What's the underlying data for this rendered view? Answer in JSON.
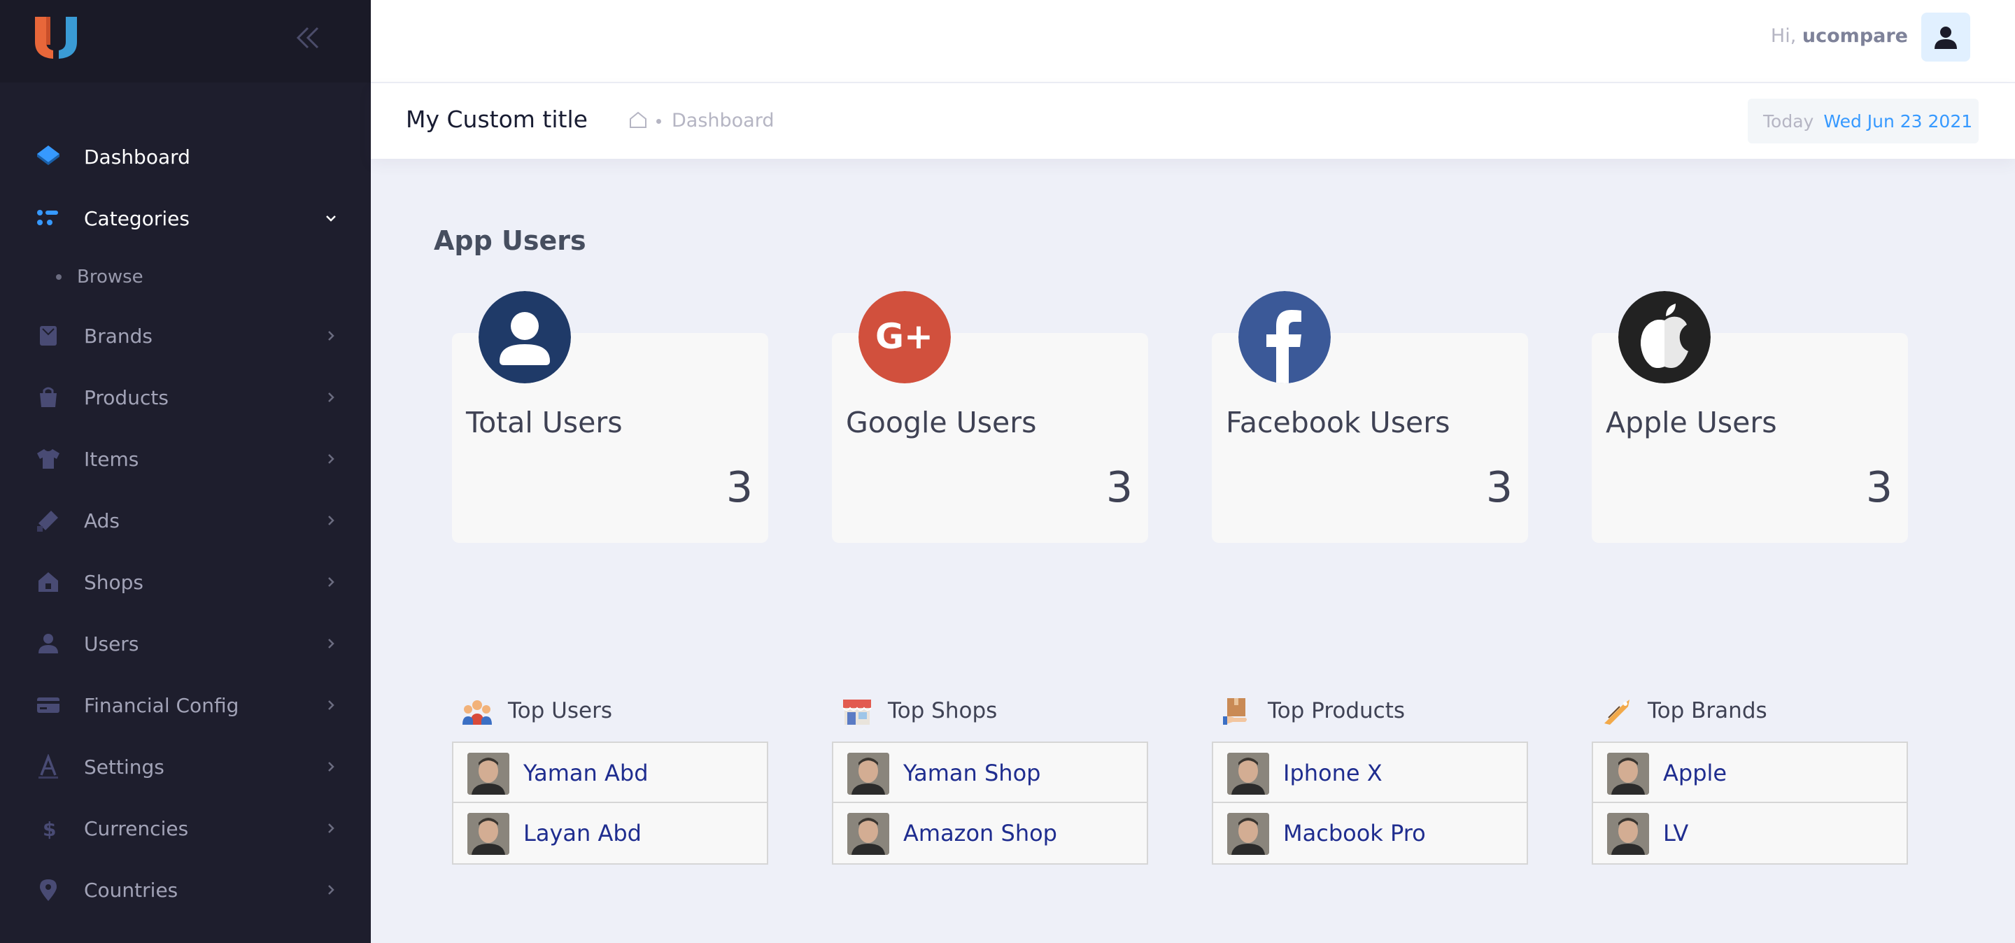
{
  "sidebar": {
    "items": [
      {
        "label": "Dashboard",
        "icon": "layers-icon"
      },
      {
        "label": "Categories",
        "icon": "categories-icon"
      },
      {
        "label": "Browse",
        "icon": "dot"
      },
      {
        "label": "Brands",
        "icon": "bookmark-icon"
      },
      {
        "label": "Products",
        "icon": "bag-icon"
      },
      {
        "label": "Items",
        "icon": "shirt-icon"
      },
      {
        "label": "Ads",
        "icon": "megaphone-icon"
      },
      {
        "label": "Shops",
        "icon": "home-icon"
      },
      {
        "label": "Users",
        "icon": "user-icon"
      },
      {
        "label": "Financial Config",
        "icon": "card-icon"
      },
      {
        "label": "Settings",
        "icon": "font-a-icon"
      },
      {
        "label": "Currencies",
        "icon": "dollar-icon"
      },
      {
        "label": "Countries",
        "icon": "map-marker-icon"
      }
    ]
  },
  "header": {
    "greeting": "Hi,",
    "username": "ucompare"
  },
  "subheader": {
    "title": "My Custom title",
    "breadcrumb": "Dashboard",
    "today_label": "Today",
    "date": "Wed Jun 23 2021"
  },
  "main": {
    "section_title": "App Users",
    "stats": [
      {
        "title": "Total Users",
        "value": "3",
        "icon": "user-circle-icon",
        "color": "#1f3a68"
      },
      {
        "title": "Google Users",
        "value": "3",
        "icon": "google-plus-icon",
        "color": "#d1503d"
      },
      {
        "title": "Facebook Users",
        "value": "3",
        "icon": "facebook-icon",
        "color": "#3b5998"
      },
      {
        "title": "Apple Users",
        "value": "3",
        "icon": "apple-icon",
        "color": "#222222"
      }
    ],
    "tops": [
      {
        "title": "Top Users",
        "icon": "users-group-icon",
        "rows": [
          "Yaman Abd",
          "Layan Abd"
        ]
      },
      {
        "title": "Top Shops",
        "icon": "shop-icon",
        "rows": [
          "Yaman Shop",
          "Amazon Shop"
        ]
      },
      {
        "title": "Top Products",
        "icon": "product-box-icon",
        "rows": [
          "Iphone X",
          "Macbook Pro"
        ]
      },
      {
        "title": "Top Brands",
        "icon": "tag-icon",
        "rows": [
          "Apple",
          "LV"
        ]
      }
    ]
  },
  "colors": {
    "sidebar_bg": "#1e1e2d",
    "accent": "#3699ff",
    "list_link": "#1f2d8f"
  }
}
